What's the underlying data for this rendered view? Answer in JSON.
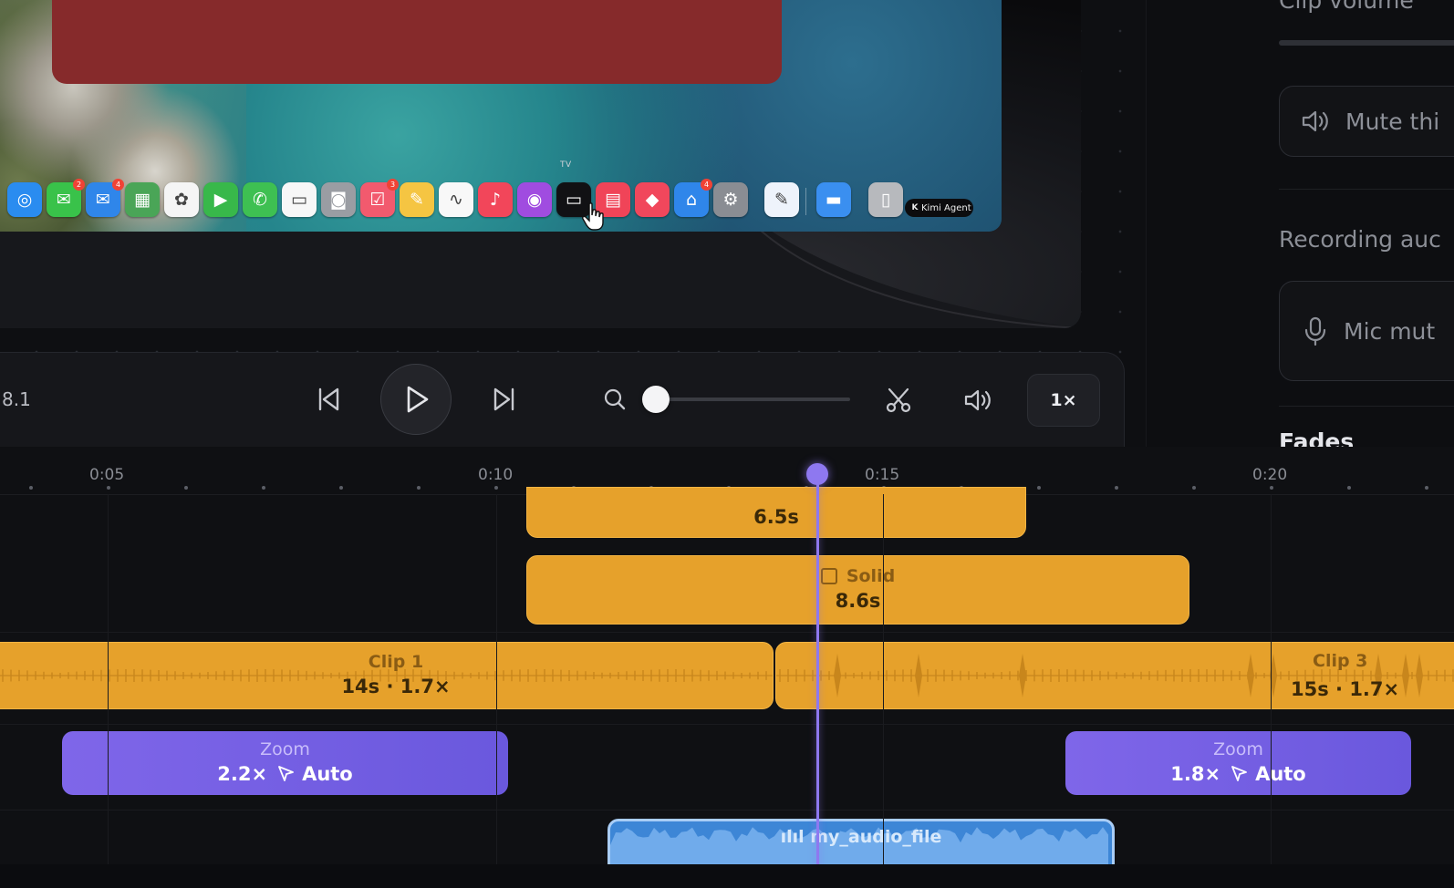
{
  "preview": {
    "dock_tooltip": "TV",
    "agent_pill_label": "Kimi Agent",
    "dock_icons": [
      {
        "name": "safari",
        "color": "#2a8cf0",
        "glyph": "◎",
        "badge": ""
      },
      {
        "name": "messages",
        "color": "#39c24a",
        "glyph": "✉",
        "badge": "2"
      },
      {
        "name": "mail",
        "color": "#2f86ea",
        "glyph": "✉",
        "badge": "4"
      },
      {
        "name": "maps",
        "color": "#4aa557",
        "glyph": "▦",
        "badge": ""
      },
      {
        "name": "photos",
        "color": "#f5f5f5",
        "glyph": "✿",
        "badge": ""
      },
      {
        "name": "facetime",
        "color": "#38b84a",
        "glyph": "▶",
        "badge": ""
      },
      {
        "name": "phone",
        "color": "#3ec052",
        "glyph": "✆",
        "badge": ""
      },
      {
        "name": "calendar",
        "color": "#f7f7f7",
        "glyph": "▭",
        "badge": ""
      },
      {
        "name": "contacts",
        "color": "#9a9da3",
        "glyph": "◙",
        "badge": ""
      },
      {
        "name": "reminders",
        "color": "#f25a6e",
        "glyph": "☑",
        "badge": "3"
      },
      {
        "name": "notes",
        "color": "#f5c542",
        "glyph": "✎",
        "badge": ""
      },
      {
        "name": "freeform",
        "color": "#f8f8f8",
        "glyph": "∿",
        "badge": ""
      },
      {
        "name": "music",
        "color": "#f2465a",
        "glyph": "♪",
        "badge": ""
      },
      {
        "name": "podcasts",
        "color": "#a04ce0",
        "glyph": "◉",
        "badge": ""
      },
      {
        "name": "tv",
        "color": "#111114",
        "glyph": "▭",
        "badge": ""
      },
      {
        "name": "news",
        "color": "#f04458",
        "glyph": "▤",
        "badge": ""
      },
      {
        "name": "arcade",
        "color": "#f1475c",
        "glyph": "◆",
        "badge": ""
      },
      {
        "name": "app-store",
        "color": "#2f86ea",
        "glyph": "⌂",
        "badge": "4"
      },
      {
        "name": "settings",
        "color": "#8a8d93",
        "glyph": "⚙",
        "badge": ""
      },
      {
        "name": "textedit",
        "color": "#eef3fb",
        "glyph": "✎",
        "badge": ""
      },
      {
        "name": "folder",
        "color": "#3a8ff0",
        "glyph": "▬",
        "badge": ""
      },
      {
        "name": "trash",
        "color": "#b7b9bd",
        "glyph": "▯",
        "badge": ""
      }
    ]
  },
  "controls": {
    "time_label": "8.1",
    "speed_label": "1×",
    "zoom_level": 0.0
  },
  "right_panel": {
    "clip_volume_label": "Clip volume",
    "mute_button_label": "Mute thi",
    "recording_audio_label": "Recording auc",
    "mic_button_label": "Mic mut",
    "fades_label": "Fades"
  },
  "timeline": {
    "ticks": [
      "0:05",
      "0:10",
      "0:15",
      "0:20"
    ],
    "clips": {
      "top_duration": "6.5s",
      "solid_label": "Solid",
      "solid_duration": "8.6s",
      "clip1_name": "Clip 1",
      "clip1_info": "14s · 1.7×",
      "clip3_name": "Clip 3",
      "clip3_info": "15s · 1.7×",
      "zoom1_label": "Zoom",
      "zoom1_value": "2.2×",
      "zoom1_mode": "Auto",
      "zoom2_label": "Zoom",
      "zoom2_value": "1.8×",
      "zoom2_mode": "Auto",
      "audio_name": "my_audio_file"
    }
  },
  "colors": {
    "accent_purple": "#8e78f0",
    "clip_orange": "#e6a12b",
    "audio_blue": "#3d86d6",
    "preview_red": "#862a2b"
  }
}
